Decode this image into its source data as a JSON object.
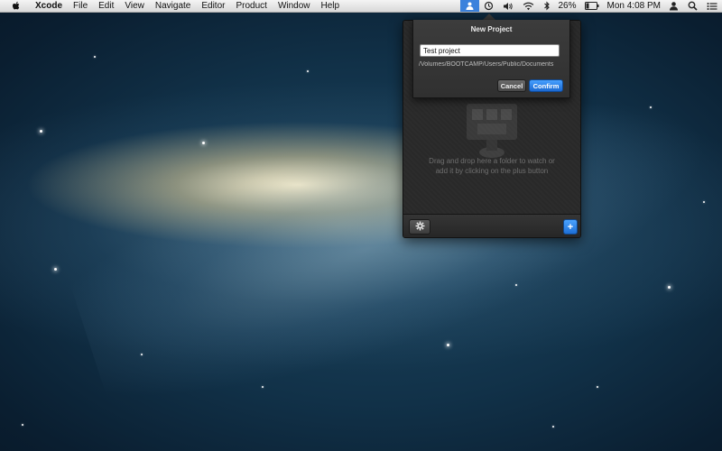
{
  "menubar": {
    "app_name": "Xcode",
    "items": [
      "File",
      "Edit",
      "View",
      "Navigate",
      "Editor",
      "Product",
      "Window",
      "Help"
    ],
    "battery_percent": "26%",
    "clock": "Mon 4:08 PM"
  },
  "colors": {
    "accent": "#2d7fe0",
    "panel_bg": "#2b2b2b"
  },
  "icons": {
    "apple": "apple-logo-icon",
    "app_status": "app-status-icon",
    "time_machine": "time-machine-icon",
    "volume": "volume-icon",
    "wifi": "wifi-icon",
    "bluetooth": "bluetooth-icon",
    "battery": "battery-icon",
    "user": "user-icon",
    "spotlight": "spotlight-icon",
    "notification": "notification-center-icon"
  },
  "panel": {
    "empty_text_line1": "Drag and drop here a folder to watch or",
    "empty_text_line2": "add it by clicking on the plus button",
    "add_label": "+"
  },
  "dialog": {
    "title": "New Project",
    "project_name_value": "Test project",
    "path": "/Volumes/BOOTCAMP/Users/Public/Documents",
    "cancel_label": "Cancel",
    "confirm_label": "Confirm"
  }
}
